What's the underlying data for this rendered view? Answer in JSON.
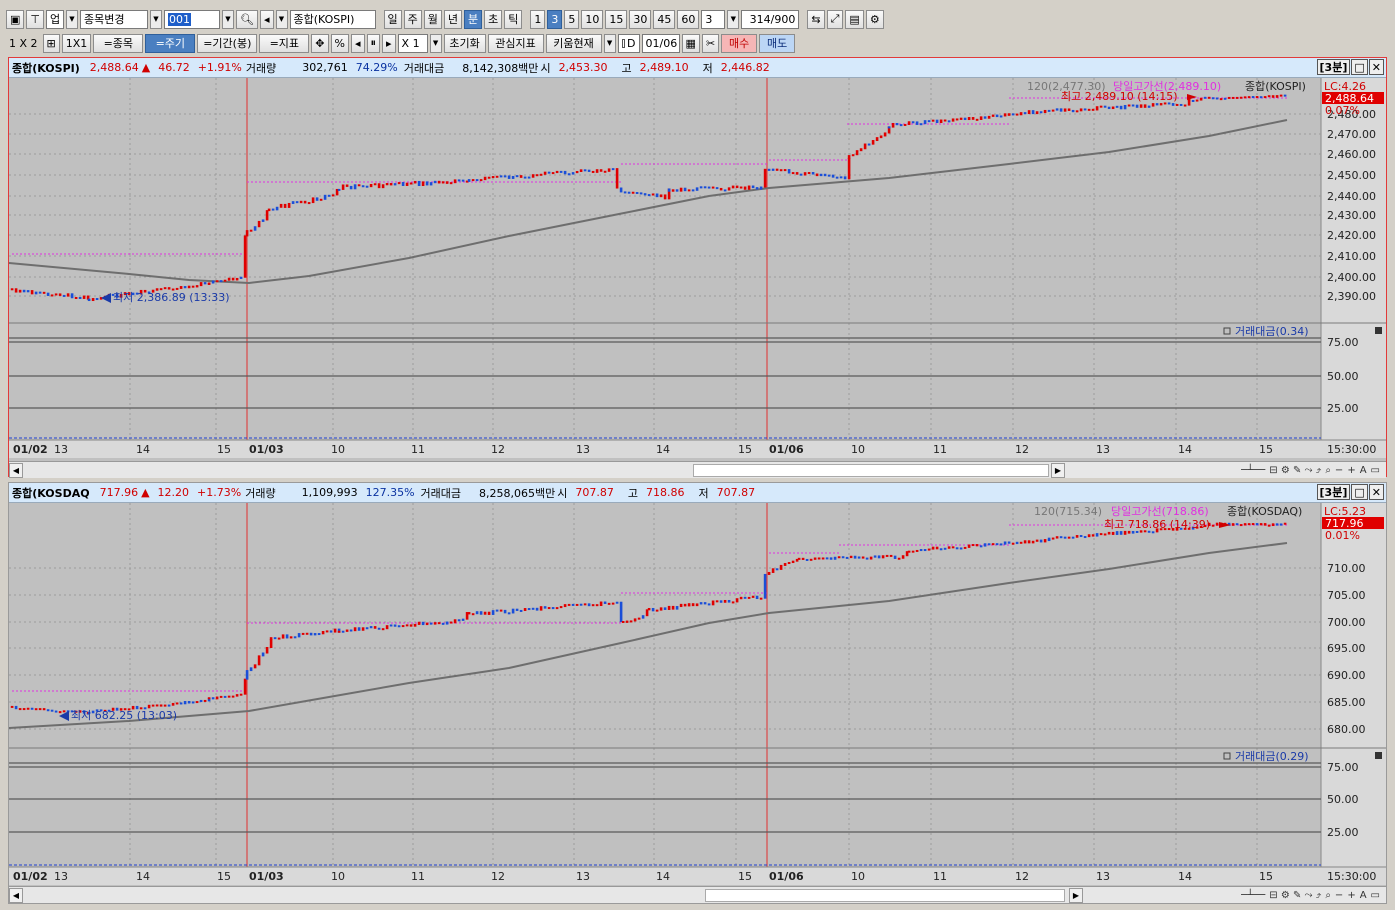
{
  "toolbar1": {
    "type_label": "업",
    "stock_change_label": "종목변경",
    "code_value": "001",
    "index_name": "종합(KOSPI)",
    "period_buttons": [
      "일",
      "주",
      "월",
      "년",
      "분",
      "초",
      "틱"
    ],
    "minute_buttons": [
      "1",
      "3",
      "5",
      "10",
      "15",
      "30",
      "45",
      "60"
    ],
    "interval_value": "3",
    "count_value": "314",
    "count_max": "/900"
  },
  "toolbar2": {
    "layout_1x2": "1 X 2",
    "layout_1x1": "1X1",
    "stock_btn": "=종목",
    "period_btn": "=주기",
    "range_btn": "=기간(봉)",
    "indicator_btn": "=지표",
    "multiplier": "X 1",
    "reset_btn": "초기화",
    "interest_btn": "관심지표",
    "kiwoom_btn": "키움현재",
    "date_check": "D",
    "date_value": "01/06",
    "buy_btn": "매수",
    "sell_btn": "매도"
  },
  "kospi": {
    "name": "종합(KOSPI)",
    "price": "2,488.64",
    "arrow": "▲",
    "change": "46.72",
    "change_pct": "+1.91%",
    "vol_label": "거래량",
    "volume": "302,761",
    "vol_pct": "74.29%",
    "amt_label": "거래대금",
    "amount": "8,142,308백만",
    "open_label": "시",
    "open": "2,453.30",
    "high_label": "고",
    "high": "2,489.10",
    "low_label": "저",
    "low": "2,446.82",
    "interval_badge": "[3분]",
    "ma_label": "120(2,477.30)",
    "hiline_label": "당일고가선(2,489.10)",
    "legend_name": "종합(KOSPI)",
    "lc_label": "LC:4.26",
    "price_tag": "2,488.64",
    "pct_tag": "0.07%",
    "max_label": "최고 2,489.10 (14:15)",
    "min_label": "최저 2,386.89 (13:33)",
    "amt_indicator": "거래대금(0.34)",
    "y_labels": [
      "2,480.00",
      "2,470.00",
      "2,460.00",
      "2,450.00",
      "2,440.00",
      "2,430.00",
      "2,420.00",
      "2,410.00",
      "2,400.00",
      "2,390.00"
    ],
    "sub_labels": [
      "75.00",
      "50.00",
      "25.00"
    ],
    "time_label": "15:30:00",
    "x_labels": [
      {
        "t": "01/02",
        "b": true
      },
      {
        "t": "13",
        "b": false
      },
      {
        "t": "14",
        "b": false
      },
      {
        "t": "15",
        "b": false
      },
      {
        "t": "01/03",
        "b": true
      },
      {
        "t": "10",
        "b": false
      },
      {
        "t": "11",
        "b": false
      },
      {
        "t": "12",
        "b": false
      },
      {
        "t": "13",
        "b": false
      },
      {
        "t": "14",
        "b": false
      },
      {
        "t": "15",
        "b": false
      },
      {
        "t": "01/06",
        "b": true
      },
      {
        "t": "10",
        "b": false
      },
      {
        "t": "11",
        "b": false
      },
      {
        "t": "12",
        "b": false
      },
      {
        "t": "13",
        "b": false
      },
      {
        "t": "14",
        "b": false
      },
      {
        "t": "15",
        "b": false
      }
    ]
  },
  "kosdaq": {
    "name": "종합(KOSDAQ",
    "price": "717.96",
    "arrow": "▲",
    "change": "12.20",
    "change_pct": "+1.73%",
    "vol_label": "거래량",
    "volume": "1,109,993",
    "vol_pct": "127.35%",
    "amt_label": "거래대금",
    "amount": "8,258,065백만",
    "open_label": "시",
    "open": "707.87",
    "high_label": "고",
    "high": "718.86",
    "low_label": "저",
    "low": "707.87",
    "interval_badge": "[3분]",
    "ma_label": "120(715.34)",
    "hiline_label": "당일고가선(718.86)",
    "legend_name": "종합(KOSDAQ)",
    "lc_label": "LC:5.23",
    "price_tag": "717.96",
    "pct_tag": "0.01%",
    "max_label": "최고 718.86 (14:39)",
    "min_label": "최저 682.25 (13:03)",
    "amt_indicator": "거래대금(0.29)",
    "y_labels": [
      "710.00",
      "705.00",
      "700.00",
      "695.00",
      "690.00",
      "685.00",
      "680.00"
    ],
    "sub_labels": [
      "75.00",
      "50.00",
      "25.00"
    ],
    "time_label": "15:30:00",
    "x_labels": [
      {
        "t": "01/02",
        "b": true
      },
      {
        "t": "13",
        "b": false
      },
      {
        "t": "14",
        "b": false
      },
      {
        "t": "15",
        "b": false
      },
      {
        "t": "01/03",
        "b": true
      },
      {
        "t": "10",
        "b": false
      },
      {
        "t": "11",
        "b": false
      },
      {
        "t": "12",
        "b": false
      },
      {
        "t": "13",
        "b": false
      },
      {
        "t": "14",
        "b": false
      },
      {
        "t": "15",
        "b": false
      },
      {
        "t": "01/06",
        "b": true
      },
      {
        "t": "10",
        "b": false
      },
      {
        "t": "11",
        "b": false
      },
      {
        "t": "12",
        "b": false
      },
      {
        "t": "13",
        "b": false
      },
      {
        "t": "14",
        "b": false
      },
      {
        "t": "15",
        "b": false
      }
    ]
  },
  "colors": {
    "up": "#e00000",
    "down": "#1a4ed8",
    "ma": "#6e6e6e",
    "hiline": "#e030e0",
    "bg": "#c0c0c0",
    "axis_bg": "#d9d9d9",
    "header_bg": "#d6e9fb"
  }
}
